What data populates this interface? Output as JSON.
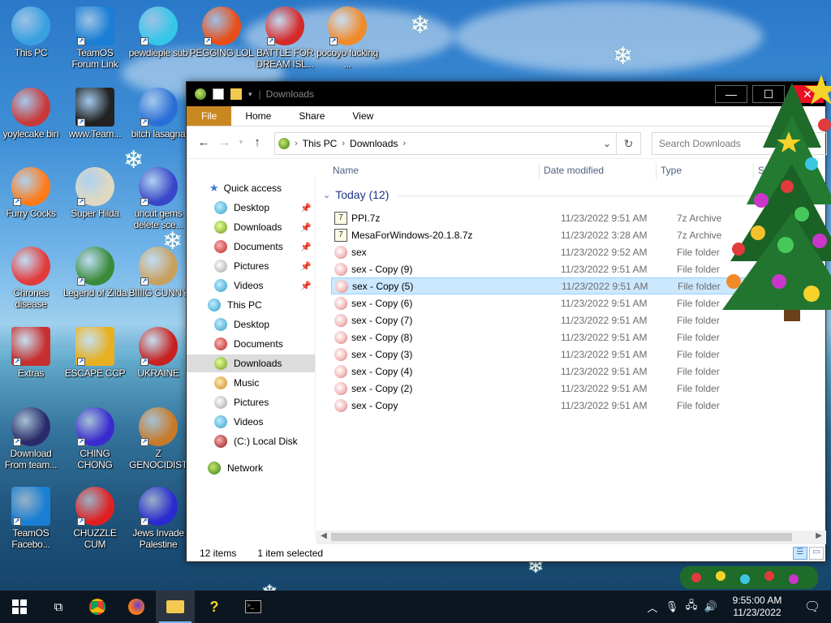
{
  "desktop": {
    "icons": [
      {
        "label": "This PC"
      },
      {
        "label": "TeamOS Forum Link"
      },
      {
        "label": "pewdiepie sub"
      },
      {
        "label": "PEGGING LOL"
      },
      {
        "label": "BATTLE FOR DREAM ISL..."
      },
      {
        "label": "pocoyo fucking ..."
      },
      {
        "label": "yoylecake bin"
      },
      {
        "label": "www.Team..."
      },
      {
        "label": "bitch lasagna"
      },
      {
        "label": "Furry Cocks"
      },
      {
        "label": "Super Hilda"
      },
      {
        "label": "uncut gems delete sce..."
      },
      {
        "label": "Chrones disease"
      },
      {
        "label": "Legend of Zilda"
      },
      {
        "label": "BIIIIG CUNNY"
      },
      {
        "label": "Extras"
      },
      {
        "label": "ESCAPE CCP"
      },
      {
        "label": "UKRAINE"
      },
      {
        "label": "Download From team..."
      },
      {
        "label": "CHING CHONG"
      },
      {
        "label": "Z GENOCIDIST"
      },
      {
        "label": "TeamOS Facebo..."
      },
      {
        "label": "CHUZZLE CUM"
      },
      {
        "label": "Jews Invade Palestine"
      }
    ]
  },
  "window": {
    "title": "Downloads",
    "ribbon_tabs": [
      "File",
      "Home",
      "Share",
      "View"
    ],
    "address": {
      "root": "This PC",
      "current": "Downloads"
    },
    "search_placeholder": "Search Downloads",
    "columns": {
      "name": "Name",
      "date": "Date modified",
      "type": "Type",
      "size": "Si"
    },
    "group_label": "Today (12)",
    "nav": {
      "quick_access": "Quick access",
      "qa_items": [
        "Desktop",
        "Downloads",
        "Documents",
        "Pictures",
        "Videos"
      ],
      "this_pc": "This PC",
      "pc_items": [
        "Desktop",
        "Documents",
        "Downloads",
        "Music",
        "Pictures",
        "Videos",
        "(C:) Local Disk"
      ],
      "network": "Network"
    },
    "files": [
      {
        "name": "PPI.7z",
        "date": "11/23/2022 9:51 AM",
        "type": "7z Archive",
        "kind": "archive"
      },
      {
        "name": "MesaForWindows-20.1.8.7z",
        "date": "11/23/2022 3:28 AM",
        "type": "7z Archive",
        "kind": "archive"
      },
      {
        "name": "sex",
        "date": "11/23/2022 9:52 AM",
        "type": "File folder",
        "kind": "folder"
      },
      {
        "name": "sex - Copy (9)",
        "date": "11/23/2022 9:51 AM",
        "type": "File folder",
        "kind": "folder"
      },
      {
        "name": "sex - Copy (5)",
        "date": "11/23/2022 9:51 AM",
        "type": "File folder",
        "kind": "folder",
        "selected": true
      },
      {
        "name": "sex - Copy (6)",
        "date": "11/23/2022 9:51 AM",
        "type": "File folder",
        "kind": "folder"
      },
      {
        "name": "sex - Copy (7)",
        "date": "11/23/2022 9:51 AM",
        "type": "File folder",
        "kind": "folder"
      },
      {
        "name": "sex - Copy (8)",
        "date": "11/23/2022 9:51 AM",
        "type": "File folder",
        "kind": "folder"
      },
      {
        "name": "sex - Copy (3)",
        "date": "11/23/2022 9:51 AM",
        "type": "File folder",
        "kind": "folder"
      },
      {
        "name": "sex - Copy (4)",
        "date": "11/23/2022 9:51 AM",
        "type": "File folder",
        "kind": "folder"
      },
      {
        "name": "sex - Copy (2)",
        "date": "11/23/2022 9:51 AM",
        "type": "File folder",
        "kind": "folder"
      },
      {
        "name": "sex - Copy",
        "date": "11/23/2022 9:51 AM",
        "type": "File folder",
        "kind": "folder"
      }
    ],
    "status": {
      "count": "12 items",
      "selection": "1 item selected"
    }
  },
  "taskbar": {
    "clock_time": "9:55:00 AM",
    "clock_date": "11/23/2022"
  },
  "colors": {
    "file_tab": "#c9881f",
    "selection": "#cce8ff",
    "close": "#e81123",
    "taskbar": "#0c1620"
  }
}
